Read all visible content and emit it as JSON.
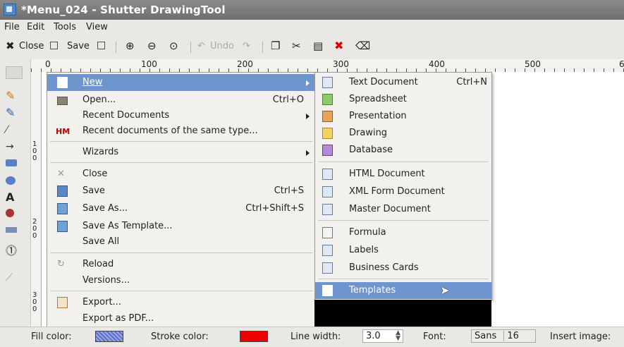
{
  "window": {
    "title": "*Menu_024 - Shutter DrawingTool"
  },
  "menubar": {
    "file": "File",
    "edit": "Edit",
    "tools": "Tools",
    "view": "View"
  },
  "toolbar": {
    "close": "Close",
    "save": "Save",
    "undo": "Undo"
  },
  "ruler": {
    "marks": [
      "0",
      "100",
      "200",
      "300",
      "400",
      "500",
      "6"
    ]
  },
  "vruler": {
    "marks": [
      "1 0 0",
      "2 0 0",
      "3 0 0"
    ]
  },
  "file_menu": {
    "items": [
      {
        "label": "New"
      },
      {
        "label": "Open...",
        "shortcut": "Ctrl+O"
      },
      {
        "label": "Recent Documents"
      },
      {
        "label": "Recent documents of the same type..."
      },
      {
        "label": "Wizards"
      },
      {
        "label": "Close"
      },
      {
        "label": "Save",
        "shortcut": "Ctrl+S"
      },
      {
        "label": "Save As...",
        "shortcut": "Ctrl+Shift+S"
      },
      {
        "label": "Save As Template..."
      },
      {
        "label": "Save All"
      },
      {
        "label": "Reload"
      },
      {
        "label": "Versions..."
      },
      {
        "label": "Export..."
      },
      {
        "label": "Export as PDF..."
      }
    ]
  },
  "new_submenu": {
    "items": [
      {
        "label": "Text Document",
        "shortcut": "Ctrl+N"
      },
      {
        "label": "Spreadsheet"
      },
      {
        "label": "Presentation"
      },
      {
        "label": "Drawing"
      },
      {
        "label": "Database"
      },
      {
        "label": "HTML Document"
      },
      {
        "label": "XML Form Document"
      },
      {
        "label": "Master Document"
      },
      {
        "label": "Formula"
      },
      {
        "label": "Labels"
      },
      {
        "label": "Business Cards"
      },
      {
        "label": "Templates"
      }
    ]
  },
  "statusbar": {
    "fill_label": "Fill color:",
    "stroke_label": "Stroke color:",
    "line_width_label": "Line width:",
    "line_width_value": "3.0",
    "font_label": "Font:",
    "font_name": "Sans",
    "font_size": "16",
    "insert_image_label": "Insert image:"
  },
  "colors": {
    "highlight": "#6f95cf",
    "stroke": "#ee0000",
    "fill": "#5d6fc4"
  }
}
